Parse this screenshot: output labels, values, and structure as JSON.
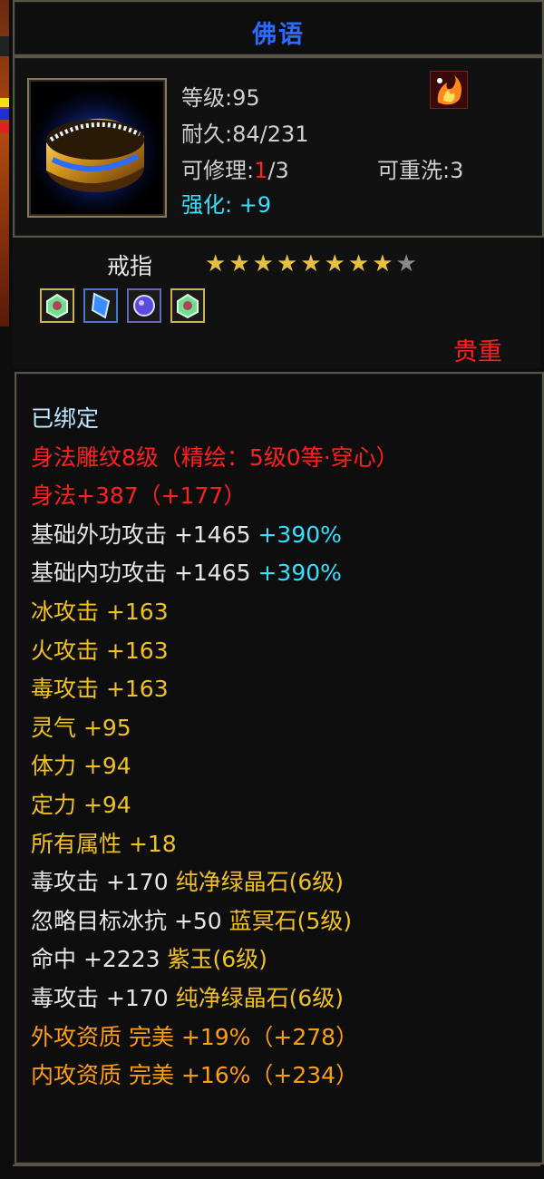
{
  "header": {
    "title": "佛语"
  },
  "item": {
    "level_label": "等级:95",
    "durability_label": "耐久:84/231",
    "repair_prefix": "可修理:",
    "repair_used": "1",
    "repair_total": "/3",
    "rewash_label": "可重洗:3",
    "enhance_label": "强化:",
    "enhance_value": "+9",
    "type": "戒指",
    "stars_filled": 8,
    "stars_total": 9,
    "rarity": "贵重",
    "item_icon": "gold-ring-icon",
    "badge_icon": "fire-element-icon",
    "gems": [
      "green-gem-icon",
      "blue-crystal-icon",
      "purple-jade-icon",
      "green-gem-icon"
    ]
  },
  "attributes": [
    {
      "parts": [
        {
          "text": "已绑定",
          "color": "bound"
        }
      ]
    },
    {
      "parts": [
        {
          "text": "身法雕纹8级（精绘：5级0等·穿心）",
          "color": "red"
        }
      ]
    },
    {
      "parts": [
        {
          "text": "身法+387（+177）",
          "color": "red"
        }
      ]
    },
    {
      "parts": [
        {
          "text": "基础外功攻击 +1465 ",
          "color": "white"
        },
        {
          "text": "+390%",
          "color": "cyan"
        }
      ]
    },
    {
      "parts": [
        {
          "text": "基础内功攻击 +1465 ",
          "color": "white"
        },
        {
          "text": "+390%",
          "color": "cyan"
        }
      ]
    },
    {
      "parts": [
        {
          "text": "冰攻击 +163",
          "color": "yellow"
        }
      ]
    },
    {
      "parts": [
        {
          "text": "火攻击 +163",
          "color": "yellow"
        }
      ]
    },
    {
      "parts": [
        {
          "text": "毒攻击 +163",
          "color": "yellow"
        }
      ]
    },
    {
      "parts": [
        {
          "text": "灵气 +95",
          "color": "yellow"
        }
      ]
    },
    {
      "parts": [
        {
          "text": "体力 +94",
          "color": "yellow"
        }
      ]
    },
    {
      "parts": [
        {
          "text": "定力 +94",
          "color": "yellow"
        }
      ]
    },
    {
      "parts": [
        {
          "text": "所有属性 +18",
          "color": "yellow"
        }
      ]
    },
    {
      "parts": [
        {
          "text": "毒攻击 +170 ",
          "color": "white"
        },
        {
          "text": "纯净绿晶石(6级)",
          "color": "yellow"
        }
      ]
    },
    {
      "parts": [
        {
          "text": "忽略目标冰抗 +50 ",
          "color": "white"
        },
        {
          "text": "蓝冥石(5级)",
          "color": "yellow"
        }
      ]
    },
    {
      "parts": [
        {
          "text": "命中 +2223 ",
          "color": "white"
        },
        {
          "text": "紫玉(6级)",
          "color": "yellow"
        }
      ]
    },
    {
      "parts": [
        {
          "text": "毒攻击 +170 ",
          "color": "white"
        },
        {
          "text": "纯净绿晶石(6级)",
          "color": "yellow"
        }
      ]
    },
    {
      "parts": [
        {
          "text": "外攻资质  完美 +19%（+278）",
          "color": "orange"
        }
      ]
    },
    {
      "parts": [
        {
          "text": "内攻资质  完美 +16%（+234）",
          "color": "orange"
        }
      ]
    }
  ]
}
